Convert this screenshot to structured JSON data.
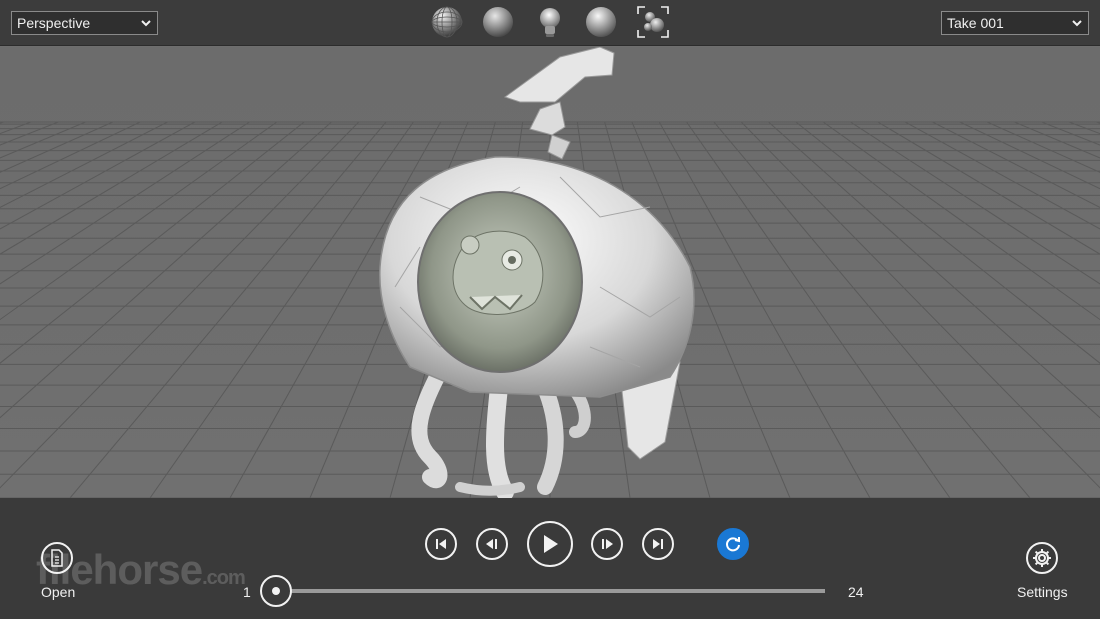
{
  "toolbar": {
    "view_select": {
      "value": "Perspective"
    },
    "take_select": {
      "value": "Take 001"
    },
    "shading_buttons": [
      {
        "icon": "wireframe-sphere-icon"
      },
      {
        "icon": "shaded-sphere-icon"
      },
      {
        "icon": "light-bulb-icon"
      },
      {
        "icon": "smooth-sphere-icon"
      },
      {
        "icon": "frame-all-icon"
      }
    ]
  },
  "viewport": {
    "grid": true
  },
  "playback": {
    "buttons": [
      "first-frame",
      "previous-frame",
      "play",
      "next-frame",
      "last-frame",
      "loop"
    ],
    "loop_color": "#1a78d4",
    "start_frame": "1",
    "end_frame": "24",
    "current_frame_fraction": 0.0
  },
  "appbar": {
    "open_label": "Open",
    "settings_label": "Settings"
  },
  "watermark": {
    "text": "filehorse",
    "suffix": ".com"
  }
}
